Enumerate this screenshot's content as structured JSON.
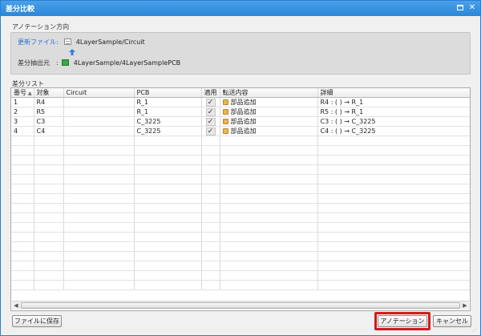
{
  "window": {
    "title": "差分比較",
    "maximize_glyph": "",
    "close_glyph": "✕"
  },
  "direction": {
    "section_label": "アノテーション方向",
    "update_label": "更新ファイル:",
    "update_value": "4LayerSample/Circuit",
    "source_label": "差分抽出元　:",
    "source_value": "4LayerSample/4LayerSamplePCB",
    "icons": {
      "update": "circuit-file-icon",
      "source": "pcb-file-icon",
      "arrow": "up-arrow-icon"
    },
    "arrow_color": "#2a82d8"
  },
  "diff_list": {
    "section_label": "差分リスト",
    "columns": [
      "番号",
      "対象",
      "Circuit",
      "PCB",
      "適用",
      "転送内容",
      "詳細"
    ],
    "sort_glyph": "▲",
    "check_glyph": "✓",
    "rows": [
      {
        "no": "1",
        "target": "R4",
        "circuit": "",
        "pcb": "R_1",
        "content": "部品追加",
        "detail": "R4 : ( ) → R_1"
      },
      {
        "no": "2",
        "target": "R5",
        "circuit": "",
        "pcb": "R_1",
        "content": "部品追加",
        "detail": "R5 : ( ) → R_1"
      },
      {
        "no": "3",
        "target": "C3",
        "circuit": "",
        "pcb": "C_3225",
        "content": "部品追加",
        "detail": "C3 : ( ) → C_3225"
      },
      {
        "no": "4",
        "target": "C4",
        "circuit": "",
        "pcb": "C_3225",
        "content": "部品追加",
        "detail": "C4 : ( ) → C_3225"
      }
    ]
  },
  "scrollbar": {
    "left_glyph": "◀",
    "right_glyph": "▶"
  },
  "buttons": {
    "save": "ファイルに保存",
    "annotate": "アノテーション",
    "cancel": "キャンセル"
  },
  "colors": {
    "titlebar": "#2b86d6",
    "highlight": "#d61a1a",
    "link_label": "#2a6fc9"
  }
}
